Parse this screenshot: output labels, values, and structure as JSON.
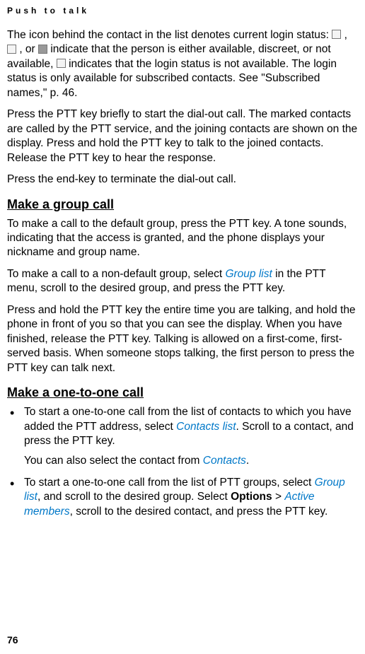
{
  "header": {
    "running_title": "Push to talk"
  },
  "content": {
    "p1_a": "The icon behind the contact in the list denotes current login status: ",
    "p1_b": ", ",
    "p1_c": ", or ",
    "p1_d": " indicate that the person is either available, discreet, or not available, ",
    "p1_e": " indicates that the login status is not available. The login status is only available for subscribed contacts. See \"Subscribed names,\" p. 46.",
    "p2": "Press the PTT key briefly to start the dial-out call. The marked contacts are called by the PTT service, and the joining contacts are shown on the display. Press and hold the PTT key to talk to the joined contacts. Release the PTT key to hear the response.",
    "p3": "Press the end-key to terminate the dial-out call.",
    "h1": "Make a group call",
    "p4": "To make a call to the default group, press the PTT key. A tone sounds, indicating that the access is granted, and the phone displays your nickname and group name.",
    "p5_a": "To make a call to a non-default group, select ",
    "p5_link": "Group list",
    "p5_b": " in the PTT menu, scroll to the desired group, and press the PTT key.",
    "p6": "Press and hold the PTT key the entire time you are talking, and hold the phone in front of you so that you can see the display. When you have finished, release the PTT key. Talking is allowed on a first-come, first-served basis. When someone stops talking, the first person to press the PTT key can talk next.",
    "h2": "Make a one-to-one call",
    "bullet1_a": "To start a one-to-one call from the list of contacts to which you have added the PTT address, select ",
    "bullet1_link": "Contacts list",
    "bullet1_b": ". Scroll to a contact, and press the PTT key.",
    "bullet1_sub_a": "You can also select the contact from ",
    "bullet1_sub_link": "Contacts",
    "bullet1_sub_b": ".",
    "bullet2_a": "To start a one-to-one call from the list of PTT groups, select ",
    "bullet2_link1": "Group list",
    "bullet2_b": ", and scroll to the desired group. Select ",
    "bullet2_bold": "Options",
    "bullet2_c": " > ",
    "bullet2_link2": "Active members",
    "bullet2_d": ", scroll to the desired contact, and press the PTT key."
  },
  "footer": {
    "page_number": "76"
  }
}
